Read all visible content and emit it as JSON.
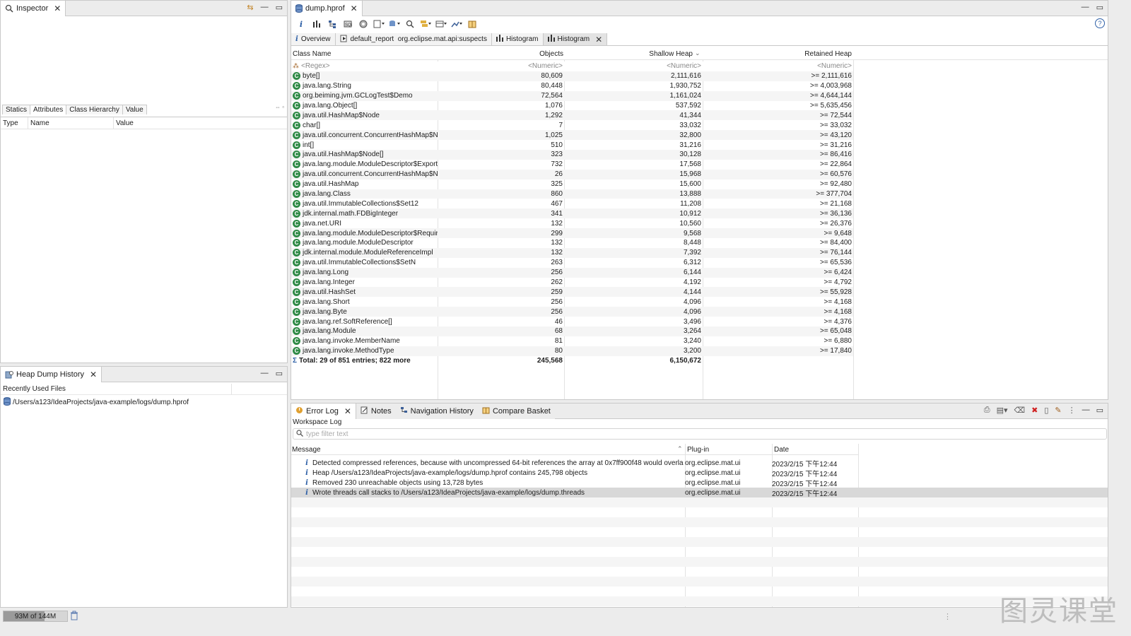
{
  "inspector": {
    "tab_title": "Inspector",
    "subtabs": [
      "Statics",
      "Attributes",
      "Class Hierarchy",
      "Value"
    ],
    "selected_subtab": "Attributes",
    "columns": [
      "Type",
      "Name",
      "Value"
    ]
  },
  "history": {
    "tab_title": "Heap Dump History",
    "section": "Recently Used Files",
    "files": [
      "/Users/a123/IdeaProjects/java-example/logs/dump.hprof"
    ]
  },
  "editor": {
    "tab_title": "dump.hprof",
    "tabs": [
      {
        "label": "Overview",
        "icon": "info-icon"
      },
      {
        "label": "default_report  org.eclipse.mat.api:suspects",
        "icon": "report-icon"
      },
      {
        "label": "Histogram",
        "icon": "histogram-icon"
      },
      {
        "label": "Histogram",
        "icon": "histogram-icon",
        "active": true
      }
    ]
  },
  "histogram": {
    "columns": [
      "Class Name",
      "Objects",
      "Shallow Heap",
      "Retained Heap"
    ],
    "filters": [
      "<Regex>",
      "<Numeric>",
      "<Numeric>",
      "<Numeric>"
    ],
    "rows": [
      [
        "byte[]",
        "80,609",
        "2,111,616",
        ">= 2,111,616"
      ],
      [
        "java.lang.String",
        "80,448",
        "1,930,752",
        ">= 4,003,968"
      ],
      [
        "org.beiming.jvm.GCLogTest$Demo",
        "72,564",
        "1,161,024",
        ">= 4,644,144"
      ],
      [
        "java.lang.Object[]",
        "1,076",
        "537,592",
        ">= 5,635,456"
      ],
      [
        "java.util.HashMap$Node",
        "1,292",
        "41,344",
        ">= 72,544"
      ],
      [
        "char[]",
        "7",
        "33,032",
        ">= 33,032"
      ],
      [
        "java.util.concurrent.ConcurrentHashMap$No",
        "1,025",
        "32,800",
        ">= 43,120"
      ],
      [
        "int[]",
        "510",
        "31,216",
        ">= 31,216"
      ],
      [
        "java.util.HashMap$Node[]",
        "323",
        "30,128",
        ">= 86,416"
      ],
      [
        "java.lang.module.ModuleDescriptor$Exports",
        "732",
        "17,568",
        ">= 22,864"
      ],
      [
        "java.util.concurrent.ConcurrentHashMap$No",
        "26",
        "15,968",
        ">= 60,576"
      ],
      [
        "java.util.HashMap",
        "325",
        "15,600",
        ">= 92,480"
      ],
      [
        "java.lang.Class",
        "860",
        "13,888",
        ">= 377,704"
      ],
      [
        "java.util.ImmutableCollections$Set12",
        "467",
        "11,208",
        ">= 21,168"
      ],
      [
        "jdk.internal.math.FDBigInteger",
        "341",
        "10,912",
        ">= 36,136"
      ],
      [
        "java.net.URI",
        "132",
        "10,560",
        ">= 26,376"
      ],
      [
        "java.lang.module.ModuleDescriptor$Require",
        "299",
        "9,568",
        ">= 9,648"
      ],
      [
        "java.lang.module.ModuleDescriptor",
        "132",
        "8,448",
        ">= 84,400"
      ],
      [
        "jdk.internal.module.ModuleReferenceImpl",
        "132",
        "7,392",
        ">= 76,144"
      ],
      [
        "java.util.ImmutableCollections$SetN",
        "263",
        "6,312",
        ">= 65,536"
      ],
      [
        "java.lang.Long",
        "256",
        "6,144",
        ">= 6,424"
      ],
      [
        "java.lang.Integer",
        "262",
        "4,192",
        ">= 4,792"
      ],
      [
        "java.util.HashSet",
        "259",
        "4,144",
        ">= 55,928"
      ],
      [
        "java.lang.Short",
        "256",
        "4,096",
        ">= 4,168"
      ],
      [
        "java.lang.Byte",
        "256",
        "4,096",
        ">= 4,168"
      ],
      [
        "java.lang.ref.SoftReference[]",
        "46",
        "3,496",
        ">= 4,376"
      ],
      [
        "java.lang.Module",
        "68",
        "3,264",
        ">= 65,048"
      ],
      [
        "java.lang.invoke.MemberName",
        "81",
        "3,240",
        ">= 6,880"
      ],
      [
        "java.lang.invoke.MethodType",
        "80",
        "3,200",
        ">= 17,840"
      ]
    ],
    "total": {
      "label": "Total: 29 of 851 entries; 822 more",
      "objects": "245,568",
      "shallow": "6,150,672"
    }
  },
  "log": {
    "tabs": [
      "Error Log",
      "Notes",
      "Navigation History",
      "Compare Basket"
    ],
    "workspace_label": "Workspace Log",
    "filter_placeholder": "type filter text",
    "columns": [
      "Message",
      "Plug-in",
      "Date"
    ],
    "entries": [
      {
        "message": "Detected compressed references, because with uncompressed 64-bit references the array at 0x7ff900f48 would overlap tl",
        "plugin": "org.eclipse.mat.ui",
        "date": "2023/2/15 下午12:44"
      },
      {
        "message": "Heap /Users/a123/IdeaProjects/java-example/logs/dump.hprof contains 245,798 objects",
        "plugin": "org.eclipse.mat.ui",
        "date": "2023/2/15 下午12:44"
      },
      {
        "message": "Removed 230 unreachable objects using 13,728 bytes",
        "plugin": "org.eclipse.mat.ui",
        "date": "2023/2/15 下午12:44"
      },
      {
        "message": "Wrote threads call stacks to /Users/a123/IdeaProjects/java-example/logs/dump.threads",
        "plugin": "org.eclipse.mat.ui",
        "date": "2023/2/15 下午12:44"
      }
    ]
  },
  "status": {
    "memory": "93M of 144M",
    "memory_used_fraction": 0.646
  },
  "watermark": "图灵课堂"
}
